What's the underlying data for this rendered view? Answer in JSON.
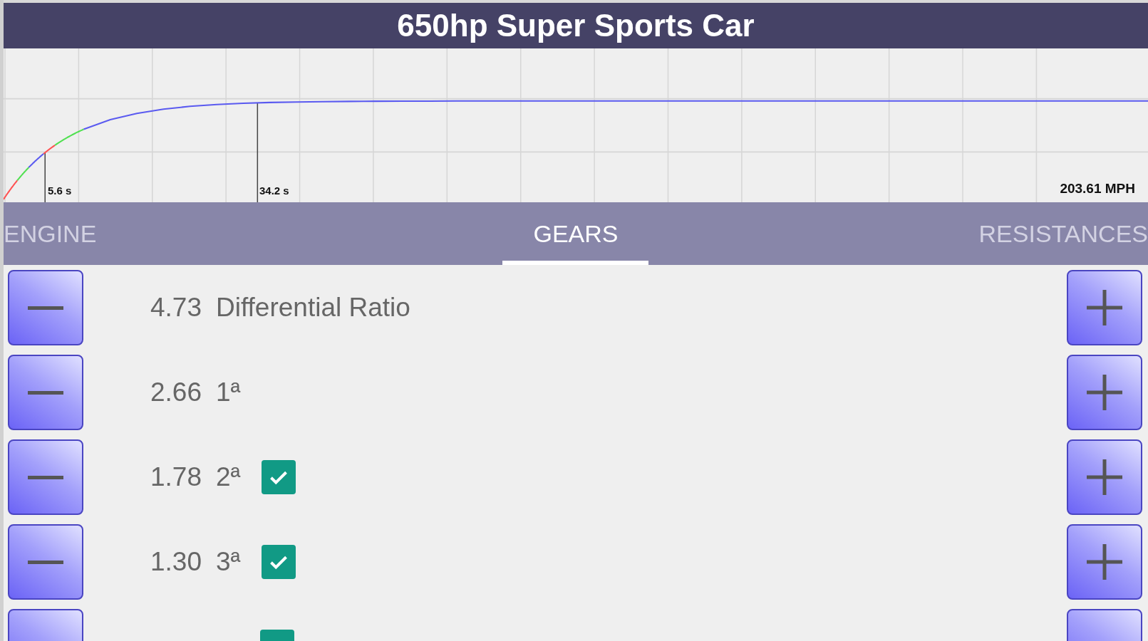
{
  "title": "650hp Super Sports Car",
  "graph": {
    "markers": [
      {
        "label": "5.6 s"
      },
      {
        "label": "34.2 s"
      }
    ],
    "top_speed": "203.61 MPH"
  },
  "tabs": [
    {
      "label": "ENGINE",
      "selected": false
    },
    {
      "label": "GEARS",
      "selected": true
    },
    {
      "label": "RESISTANCES",
      "selected": false
    }
  ],
  "rows": [
    {
      "kind": "plain",
      "value": "4.73",
      "label": "Differential Ratio"
    },
    {
      "kind": "plain",
      "value": "2.66",
      "label": "1ª"
    },
    {
      "kind": "toggle",
      "value": "1.78",
      "label": "2ª",
      "checked": true
    },
    {
      "kind": "toggle",
      "value": "1.30",
      "label": "3ª",
      "checked": true
    },
    {
      "kind": "toggle",
      "checked": true
    }
  ]
}
